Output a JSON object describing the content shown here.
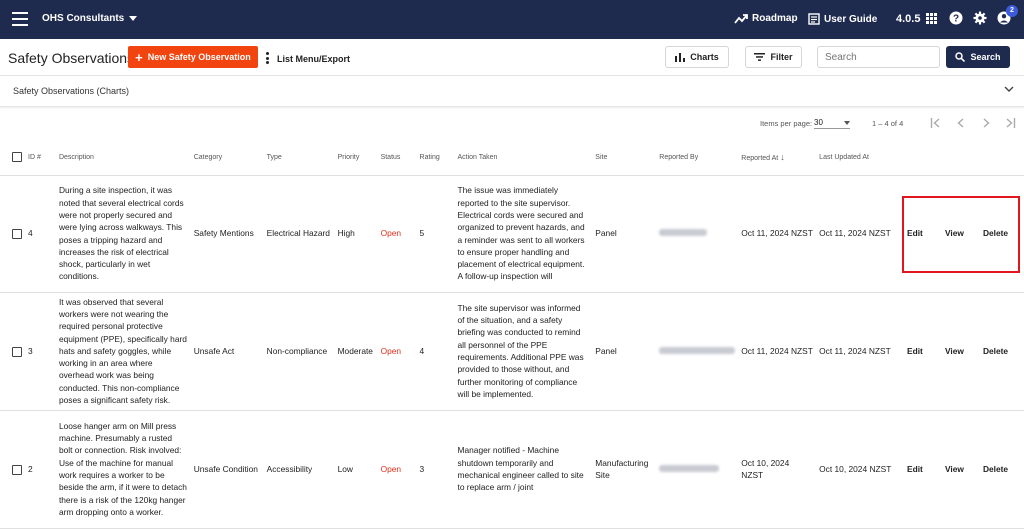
{
  "topbar": {
    "org": "OHS Consultants",
    "roadmap": "Roadmap",
    "user_guide": "User Guide",
    "version": "4.0.5",
    "notif_count": "2"
  },
  "toolbar": {
    "title": "Safety Observations",
    "new_label": "New Safety Observation",
    "list_menu": "List Menu/Export",
    "charts": "Charts",
    "filter": "Filter",
    "search_placeholder": "Search",
    "search_btn": "Search"
  },
  "charts_section": {
    "label": "Safety Observations (Charts)"
  },
  "pagination": {
    "items_per_page_label": "Items per page:",
    "per_page": "30",
    "range": "1 – 4 of 4"
  },
  "table": {
    "headers": {
      "id": "ID #",
      "description": "Description",
      "category": "Category",
      "type": "Type",
      "priority": "Priority",
      "status": "Status",
      "rating": "Rating",
      "action": "Action Taken",
      "site": "Site",
      "reported_by": "Reported By",
      "reported_at": "Reported At",
      "updated": "Last Updated At"
    },
    "actions": {
      "edit": "Edit",
      "view": "View",
      "delete": "Delete"
    },
    "rows": [
      {
        "id": "4",
        "description": "During a site inspection, it was noted that several electrical cords were not properly secured and were lying across walkways. This poses a tripping hazard and increases the risk of electrical shock, particularly in wet conditions.",
        "category": "Safety Mentions",
        "type": "Electrical Hazard",
        "priority": "High",
        "status": "Open",
        "rating": "5",
        "action": "The issue was immediately reported to the site supervisor. Electrical cords were secured and organized to prevent hazards, and a reminder was sent to all workers to ensure proper handling and placement of electrical equipment. A follow-up inspection will",
        "site": "Panel",
        "reported_at": "Oct 11, 2024 NZST",
        "updated": "Oct 11, 2024 NZST"
      },
      {
        "id": "3",
        "description": "It was observed that several workers were not wearing the required personal protective equipment (PPE), specifically hard hats and safety goggles, while working in an area where overhead work was being conducted. This non-compliance poses a significant safety risk.",
        "category": "Unsafe Act",
        "type": "Non-compliance",
        "priority": "Moderate",
        "status": "Open",
        "rating": "4",
        "action": "The site supervisor was informed of the situation, and a safety briefing was conducted to remind all personnel of the PPE requirements. Additional PPE was provided to those without, and further monitoring of compliance will be implemented.",
        "site": "Panel",
        "reported_at": "Oct 11, 2024 NZST",
        "updated": "Oct 11, 2024 NZST"
      },
      {
        "id": "2",
        "description": "Loose hanger arm on Mill press machine. Presumably a rusted bolt or connection. Risk involved: Use of the machine for manual work requires a worker to be beside the arm, if it were to detach there is a risk of the 120kg hanger arm dropping onto a worker.",
        "category": "Unsafe Condition",
        "type": "Accessibility",
        "priority": "Low",
        "status": "Open",
        "rating": "3",
        "action": "Manager notified - Machine shutdown temporarily and mechanical engineer called to site to replace arm / joint",
        "site": "Manufacturing Site",
        "reported_at": "Oct 10, 2024 NZST",
        "updated": "Oct 10, 2024 NZST"
      }
    ]
  }
}
